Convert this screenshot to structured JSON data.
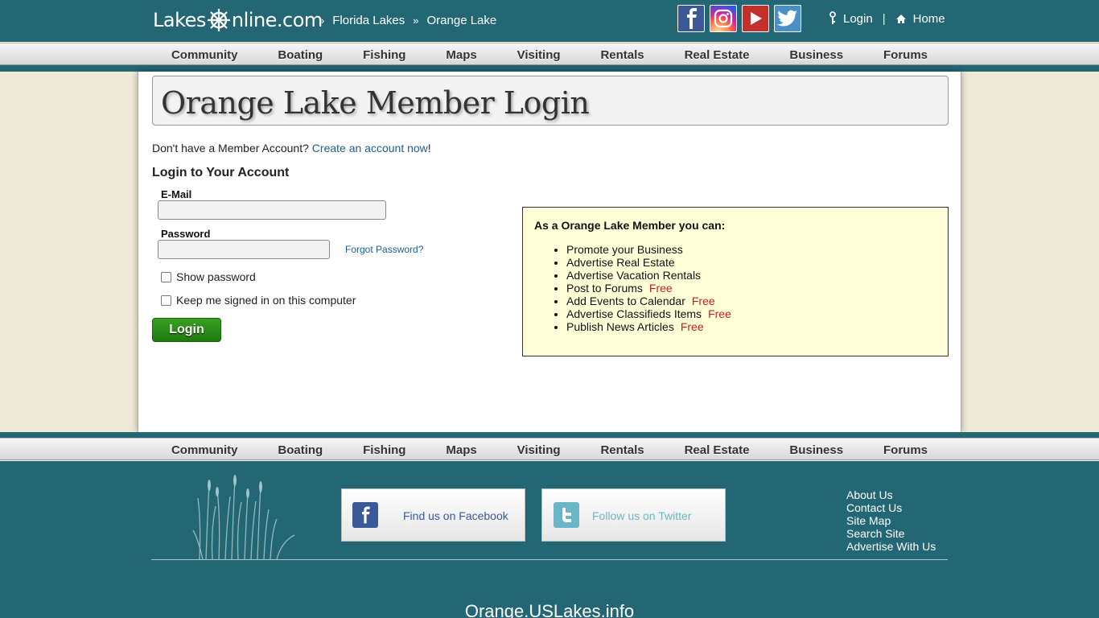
{
  "header": {
    "logo_left": "Lakes",
    "logo_right": "nline.com",
    "breadcrumbs": [
      {
        "label": "Florida Lakes"
      },
      {
        "label": "Orange Lake"
      }
    ],
    "crumb_sep": "»",
    "login": "Login",
    "home": "Home"
  },
  "social_icons": [
    "facebook-icon",
    "instagram-icon",
    "youtube-icon",
    "twitter-icon"
  ],
  "nav": [
    "Community",
    "Boating",
    "Fishing",
    "Maps",
    "Visiting",
    "Rentals",
    "Real Estate",
    "Business",
    "Forums"
  ],
  "main": {
    "title": "Orange Lake Member Login",
    "no_account": "Don't have a Member Account?",
    "create_link": "Create an account now",
    "create_suffix": "!",
    "login_heading": "Login to Your Account",
    "email_label": "E-Mail",
    "email_value": "",
    "password_label": "Password",
    "password_value": "",
    "forgot": "Forgot Password?",
    "show_password": "Show password",
    "keep_signed": "Keep me signed in on this computer",
    "login_button": "Login"
  },
  "benefits": {
    "heading": "As a Orange Lake Member you can:",
    "items": [
      {
        "text": "Promote your Business",
        "badge": ""
      },
      {
        "text": "Advertise Real Estate",
        "badge": ""
      },
      {
        "text": "Advertise Vacation Rentals",
        "badge": ""
      },
      {
        "text": "Post to Forums",
        "badge": "Free"
      },
      {
        "text": "Add Events to Calendar",
        "badge": "Free"
      },
      {
        "text": "Advertise Classifieds Items",
        "badge": "Free"
      },
      {
        "text": "Publish News Articles",
        "badge": "Free"
      }
    ]
  },
  "footer": {
    "facebook": "Find us on Facebook",
    "twitter": "Follow us on Twitter",
    "links": [
      "About Us",
      "Contact Us",
      "Site Map",
      "Search Site",
      "Advertise With Us"
    ],
    "site_name": "Orange.USLakes.info"
  },
  "colors": {
    "header_bg": "#236674",
    "free_badge": "#c81e1e",
    "login_button": "#2b8c18",
    "benefits_bg": "#ffffd8"
  }
}
